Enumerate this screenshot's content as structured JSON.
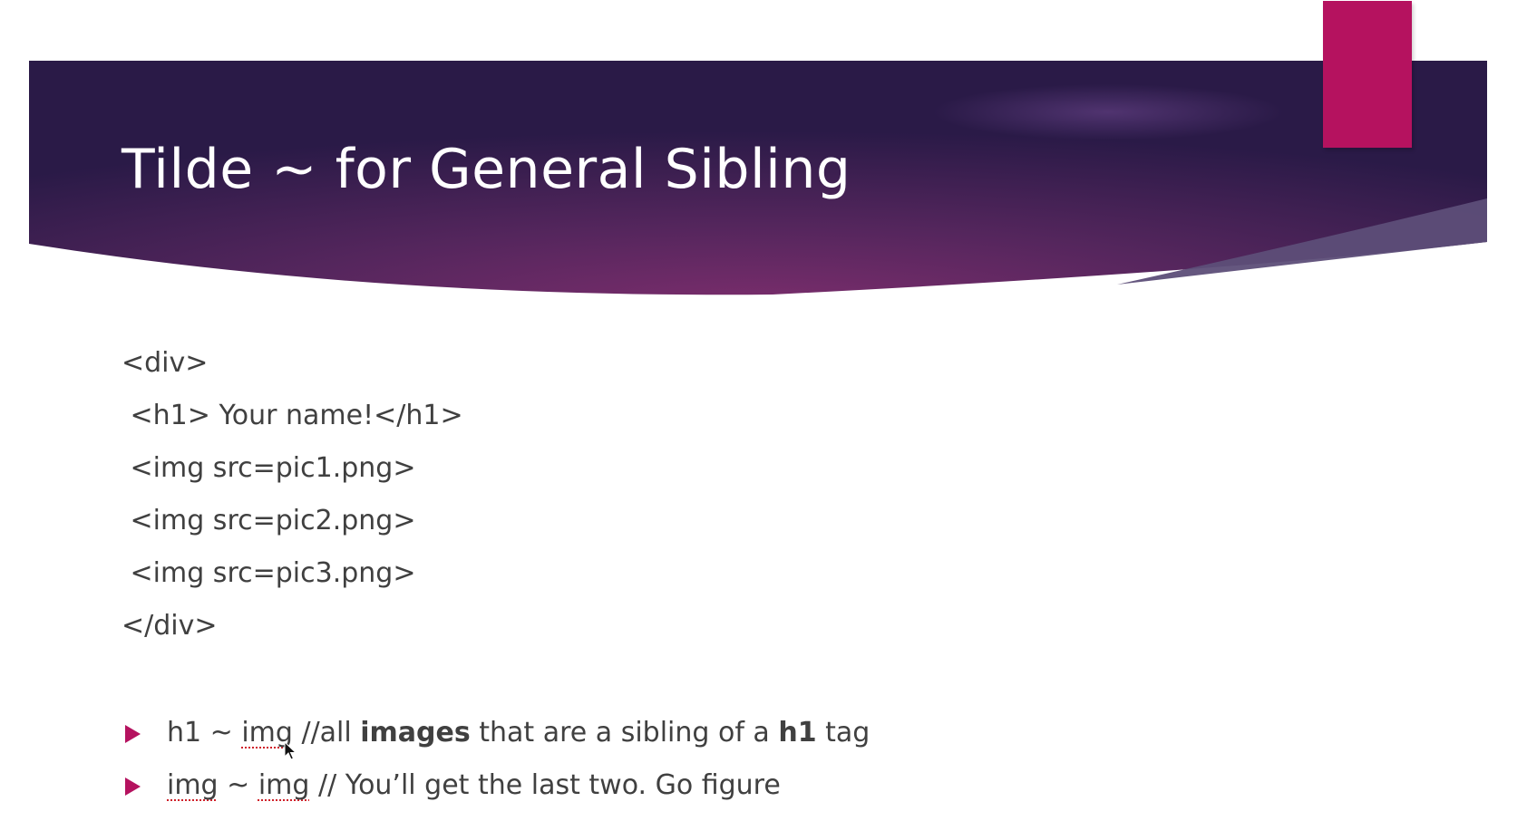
{
  "slide": {
    "title": "Tilde ~ for General Sibling",
    "code_lines": [
      "<div>",
      " <h1> Your name!</h1>",
      " <img src=pic1.png>",
      " <img src=pic2.png>",
      " <img src=pic3.png>",
      "</div>"
    ],
    "bullets": [
      {
        "a": "h1 ~ ",
        "b": "img",
        "c": " //all ",
        "d": "images",
        "e": " that are a sibling of a ",
        "f": "h1",
        "g": " tag"
      },
      {
        "a": "img",
        "b": " ~ ",
        "c": "img",
        "d": " // You’ll get the last two. Go figure"
      }
    ]
  },
  "colors": {
    "banner_dark": "#2c1b4a",
    "banner_mid": "#6b2a66",
    "accent": "#b5125f",
    "body_text": "#404040",
    "title_text": "#ffffff"
  },
  "icons": {
    "bullet": "triangle-right-icon",
    "cursor": "mouse-pointer-icon"
  }
}
